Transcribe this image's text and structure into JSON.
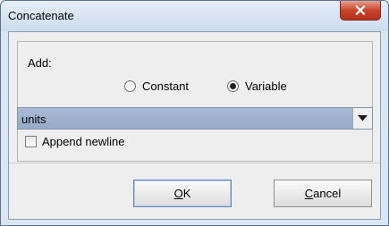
{
  "window": {
    "title": "Concatenate"
  },
  "form": {
    "add_label": "Add:",
    "radios": [
      {
        "label": "Constant",
        "selected": false
      },
      {
        "label": "Variable",
        "selected": true
      }
    ],
    "combo": {
      "value": "units"
    },
    "checkbox": {
      "label": "Append newline",
      "checked": false
    }
  },
  "buttons": {
    "ok": {
      "mnemonic": "O",
      "rest": "K"
    },
    "cancel": {
      "mnemonic": "C",
      "rest": "ancel"
    }
  },
  "icons": {
    "close": "close-icon",
    "dropdown": "chevron-down-icon"
  }
}
